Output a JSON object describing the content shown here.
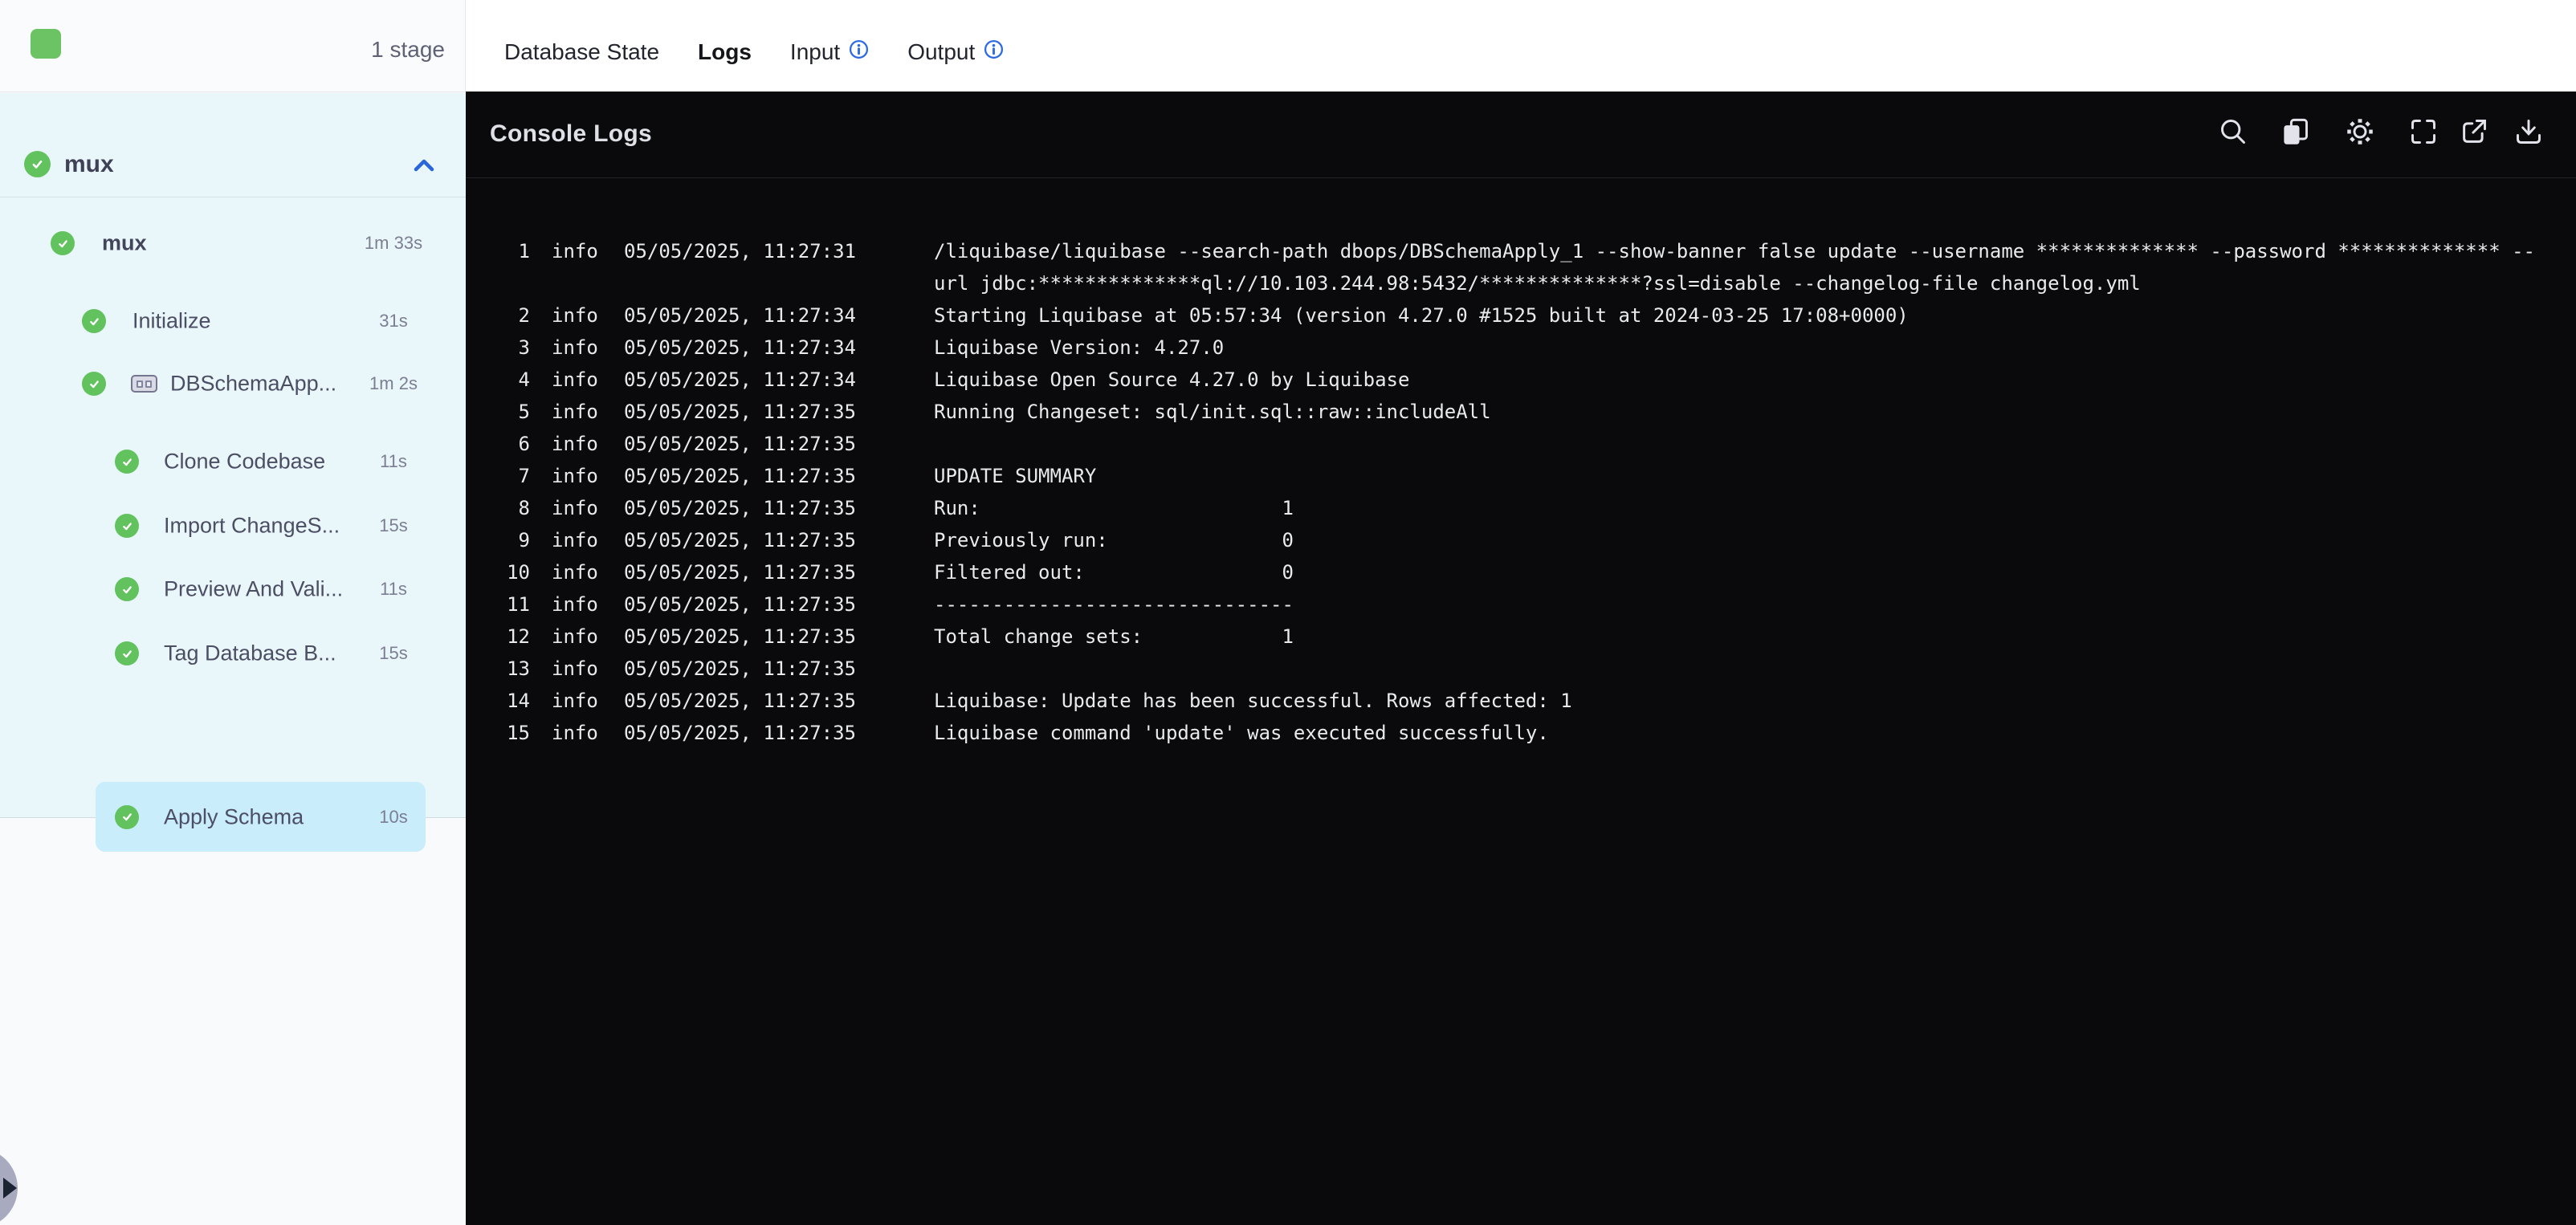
{
  "sidebar": {
    "stage_count": "1 stage",
    "group_label": "mux",
    "steps": [
      {
        "label": "mux",
        "duration": "1m 33s",
        "indent": 0,
        "bold": true
      },
      {
        "label": "Initialize",
        "duration": "31s",
        "indent": 1
      },
      {
        "label": "DBSchemaApp...",
        "duration": "1m 2s",
        "indent": 1,
        "icon": "step-group-icon"
      },
      {
        "label": "Clone Codebase",
        "duration": "11s",
        "indent": 2
      },
      {
        "label": "Import ChangeS...",
        "duration": "15s",
        "indent": 2
      },
      {
        "label": "Preview And Vali...",
        "duration": "11s",
        "indent": 2
      },
      {
        "label": "Tag Database B...",
        "duration": "15s",
        "indent": 2
      },
      {
        "label": "Apply Schema",
        "duration": "10s",
        "indent": 2,
        "selected": true
      }
    ]
  },
  "tabs": [
    {
      "label": "Database State"
    },
    {
      "label": "Logs",
      "active": true
    },
    {
      "label": "Input",
      "info": true
    },
    {
      "label": "Output",
      "info": true
    }
  ],
  "console": {
    "title": "Console Logs",
    "toolbar_icons": [
      "search",
      "copy",
      "settings",
      "fullscreen",
      "open-in-new",
      "download"
    ],
    "logs": [
      {
        "num": "1",
        "level": "info",
        "time": "05/05/2025, 11:27:31",
        "rows": [
          "/liquibase/liquibase --search-path dbops/DBSchemaApply_1 --show-banner false update --username ************** --password ************** --",
          "url jdbc:**************ql://10.103.244.98:5432/**************?ssl=disable --changelog-file changelog.yml"
        ]
      },
      {
        "num": "2",
        "level": "info",
        "time": "05/05/2025, 11:27:34",
        "rows": [
          "Starting Liquibase at 05:57:34 (version 4.27.0 #1525 built at 2024-03-25 17:08+0000)"
        ]
      },
      {
        "num": "3",
        "level": "info",
        "time": "05/05/2025, 11:27:34",
        "rows": [
          "Liquibase Version: 4.27.0"
        ]
      },
      {
        "num": "4",
        "level": "info",
        "time": "05/05/2025, 11:27:34",
        "rows": [
          "Liquibase Open Source 4.27.0 by Liquibase"
        ]
      },
      {
        "num": "5",
        "level": "info",
        "time": "05/05/2025, 11:27:35",
        "rows": [
          "Running Changeset: sql/init.sql::raw::includeAll"
        ]
      },
      {
        "num": "6",
        "level": "info",
        "time": "05/05/2025, 11:27:35",
        "rows": [
          ""
        ]
      },
      {
        "num": "7",
        "level": "info",
        "time": "05/05/2025, 11:27:35",
        "rows": [
          "UPDATE SUMMARY"
        ]
      },
      {
        "num": "8",
        "level": "info",
        "time": "05/05/2025, 11:27:35",
        "rows": [
          "Run:                          1"
        ]
      },
      {
        "num": "9",
        "level": "info",
        "time": "05/05/2025, 11:27:35",
        "rows": [
          "Previously run:               0"
        ]
      },
      {
        "num": "10",
        "level": "info",
        "time": "05/05/2025, 11:27:35",
        "rows": [
          "Filtered out:                 0"
        ]
      },
      {
        "num": "11",
        "level": "info",
        "time": "05/05/2025, 11:27:35",
        "rows": [
          "-------------------------------"
        ]
      },
      {
        "num": "12",
        "level": "info",
        "time": "05/05/2025, 11:27:35",
        "rows": [
          "Total change sets:            1"
        ]
      },
      {
        "num": "13",
        "level": "info",
        "time": "05/05/2025, 11:27:35",
        "rows": [
          ""
        ]
      },
      {
        "num": "14",
        "level": "info",
        "time": "05/05/2025, 11:27:35",
        "rows": [
          "Liquibase: Update has been successful. Rows affected: 1"
        ]
      },
      {
        "num": "15",
        "level": "info",
        "time": "05/05/2025, 11:27:35",
        "rows": [
          "Liquibase command 'update' was executed successfully."
        ]
      }
    ]
  },
  "colors": {
    "success_green": "#61c25e",
    "accent_blue": "#2e6be2",
    "selected_step_bg": "#c9edfb",
    "console_bg": "#0a0a0c"
  }
}
